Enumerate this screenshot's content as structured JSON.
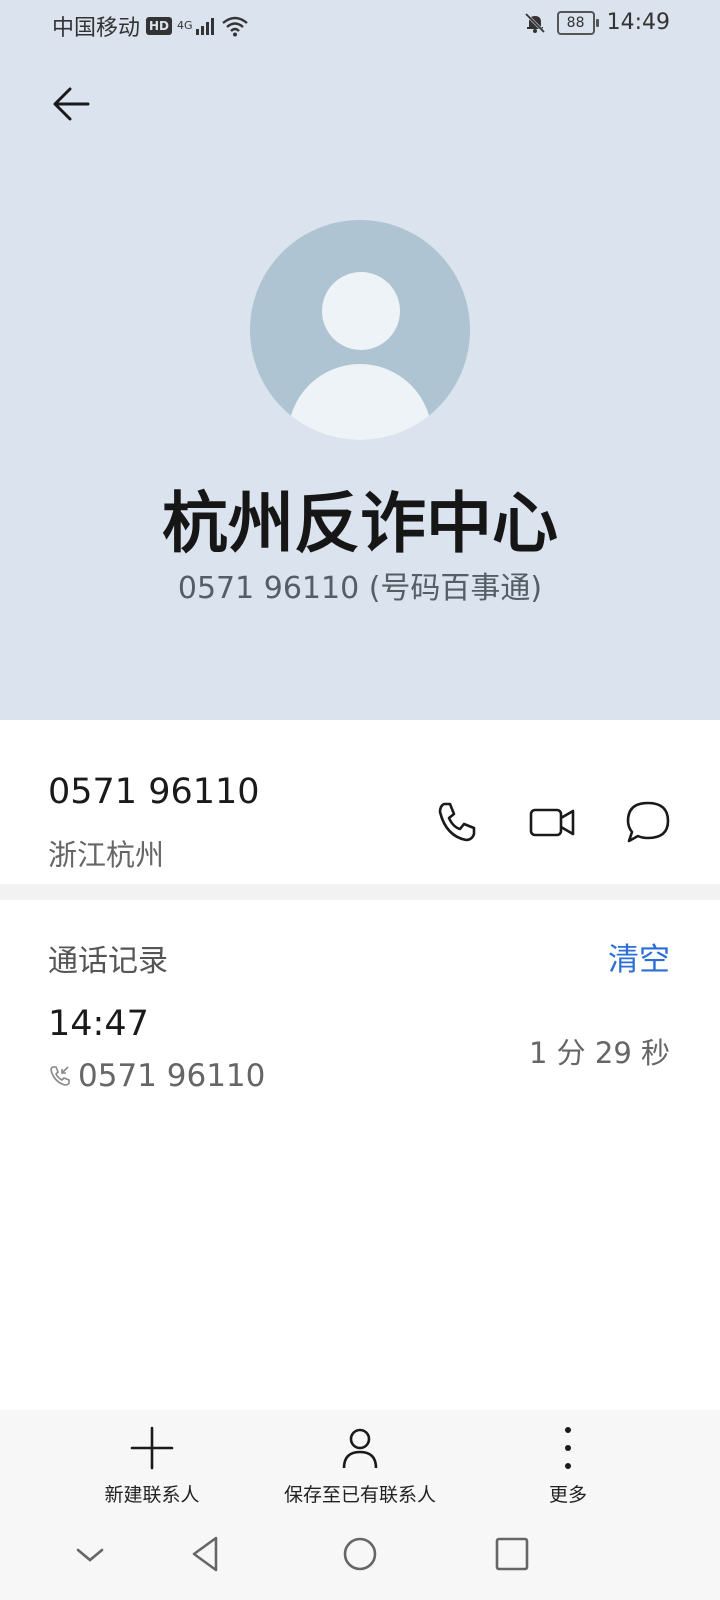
{
  "status": {
    "carrier": "中国移动",
    "hd": "HD",
    "network": "4G",
    "battery": "88",
    "time": "14:49"
  },
  "contact": {
    "name": "杭州反诈中心",
    "subtitle": "0571 96110 (号码百事通)",
    "number": "0571 96110",
    "location": "浙江杭州"
  },
  "call_log": {
    "title": "通话记录",
    "clear_label": "清空",
    "entries": [
      {
        "time": "14:47",
        "number": "0571 96110",
        "duration": "1 分 29 秒"
      }
    ]
  },
  "bottom_bar": {
    "new_contact": "新建联系人",
    "save_existing": "保存至已有联系人",
    "more": "更多"
  },
  "colors": {
    "header_bg": "#dae3ee",
    "avatar_bg": "#aec4d3",
    "accent": "#2b6fd6"
  },
  "icons": [
    "back-arrow-icon",
    "phone-icon",
    "video-call-icon",
    "message-icon",
    "incoming-call-icon",
    "plus-icon",
    "person-icon",
    "more-vertical-icon",
    "nav-back-icon",
    "nav-home-icon",
    "nav-recents-icon",
    "nav-collapse-icon"
  ]
}
